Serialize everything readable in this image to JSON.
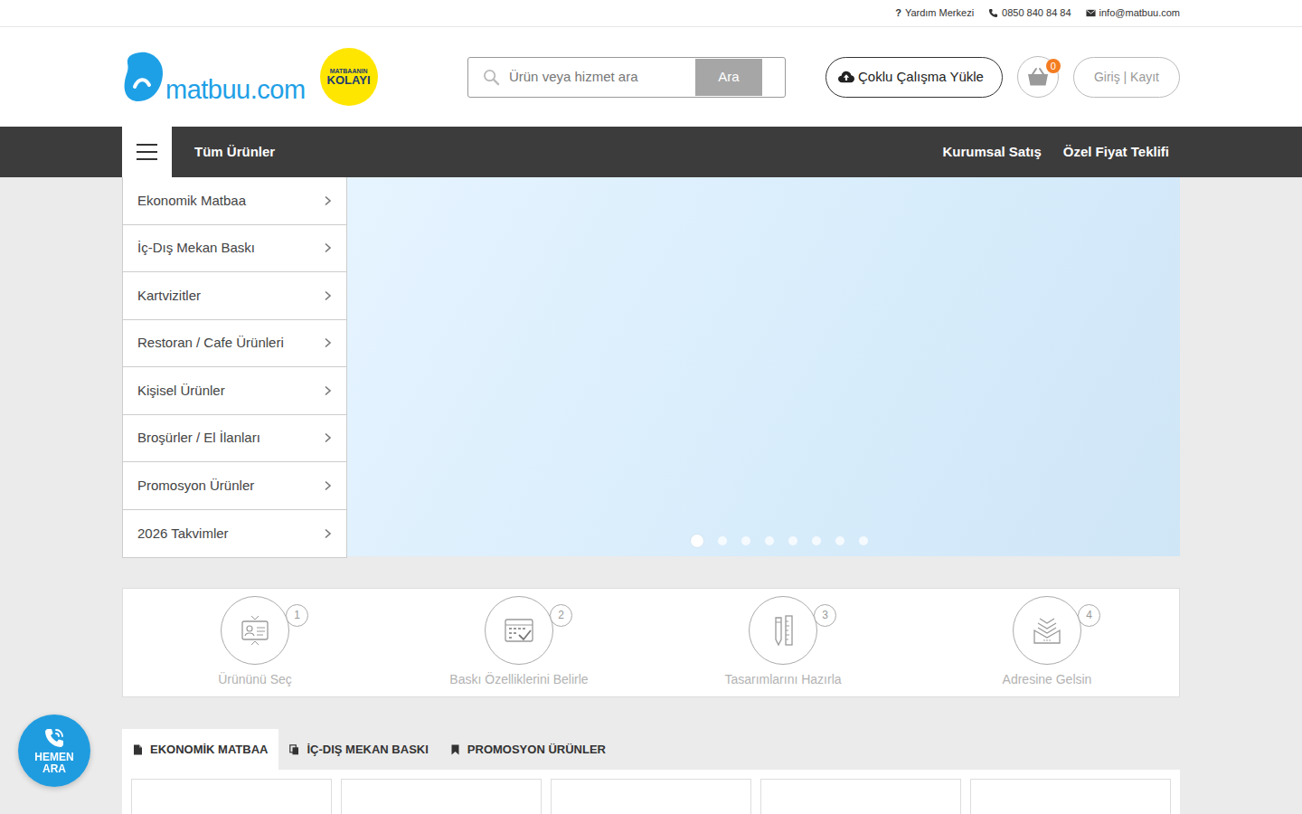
{
  "topbar": {
    "links": [
      {
        "kind": "help",
        "icon": "?",
        "label": "Yardım Merkezi"
      },
      {
        "kind": "phone",
        "label": "0850 840 84 84"
      },
      {
        "kind": "mail",
        "label": "info@matbuu.com"
      }
    ]
  },
  "logo": {
    "text": "matbuu.com",
    "badge_line1": "MATBAANIN",
    "badge_line2": "KOLAYI"
  },
  "search": {
    "placeholder": "Ürün veya hizmet ara",
    "button": "Ara"
  },
  "upload_button": "Çoklu Çalışma Yükle",
  "cart": {
    "count": "0"
  },
  "auth": "Giriş | Kayıt",
  "nav": {
    "label": "Tüm Ürünler",
    "links": [
      "Kurumsal Satış",
      "Özel Fiyat Teklifi"
    ]
  },
  "categories": [
    "Ekonomik Matbaa",
    "İç-Dış Mekan Baskı",
    "Kartvizitler",
    "Restoran / Cafe Ürünleri",
    "Kişisel Ürünler",
    "Broşürler / El İlanları",
    "Promosyon Ürünler",
    "2026 Takvimler"
  ],
  "carousel": {
    "dots": [
      {
        "selected": true
      },
      {
        "selected": false
      },
      {
        "selected": false
      },
      {
        "selected": false
      },
      {
        "selected": false
      },
      {
        "selected": false
      },
      {
        "selected": false
      },
      {
        "selected": false
      }
    ]
  },
  "steps": [
    {
      "kind": "card",
      "number": "1",
      "label": "Ürününü Seç"
    },
    {
      "kind": "calendar",
      "number": "2",
      "label": "Baskı Özelliklerini Belirle"
    },
    {
      "kind": "pencil",
      "number": "3",
      "label": "Tasarımlarını Hazırla"
    },
    {
      "kind": "box",
      "number": "4",
      "label": "Adresine Gelsin"
    }
  ],
  "tabs": [
    {
      "kind": "doc",
      "label": "EKONOMİK MATBAA",
      "selected": true
    },
    {
      "kind": "copy",
      "label": "İÇ-DIŞ MEKAN BASKI",
      "selected": false
    },
    {
      "kind": "bookmark",
      "label": "PROMOSYON ÜRÜNLER",
      "selected": false
    }
  ],
  "call_button": {
    "line1": "HEMEN",
    "line2": "ARA"
  }
}
